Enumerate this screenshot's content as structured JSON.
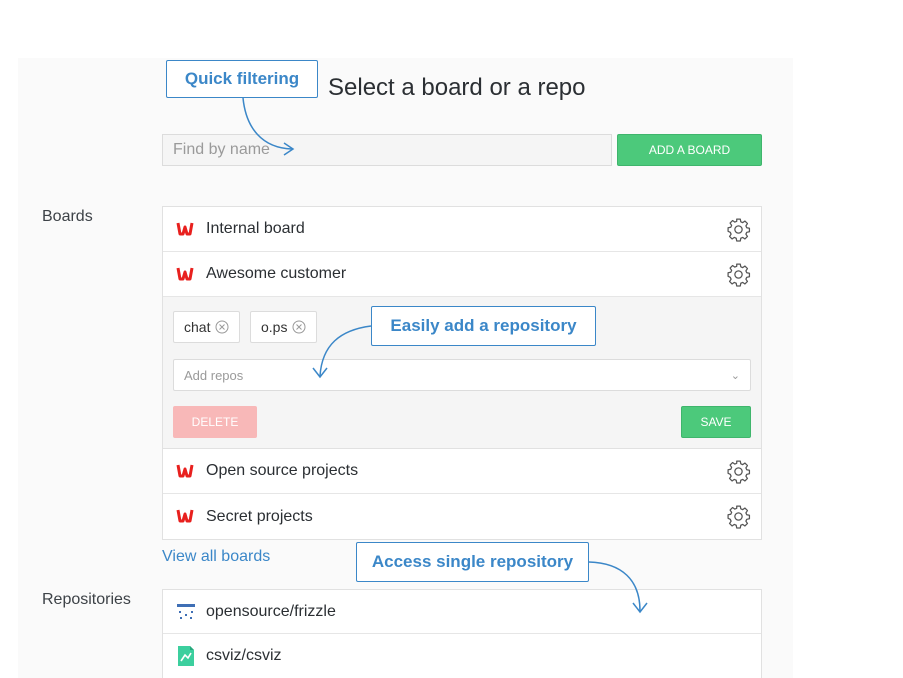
{
  "header": {
    "title": "Select a board or a repo"
  },
  "search": {
    "placeholder": "Find by name"
  },
  "toolbar": {
    "add_board_label": "ADD A BOARD"
  },
  "sections": {
    "boards_label": "Boards",
    "repositories_label": "Repositories"
  },
  "boards": [
    {
      "name": "Internal board"
    },
    {
      "name": "Awesome customer"
    },
    {
      "name": "Open source projects"
    },
    {
      "name": "Secret projects"
    }
  ],
  "editor": {
    "chips": [
      {
        "label": "chat"
      },
      {
        "label": "o.ps"
      }
    ],
    "add_repos_placeholder": "Add repos",
    "delete_label": "DELETE",
    "save_label": "SAVE"
  },
  "view_all_boards": "View all boards",
  "repositories": [
    {
      "name": "opensource/frizzle"
    },
    {
      "name": "csviz/csviz"
    }
  ],
  "callouts": {
    "quick_filtering": "Quick filtering",
    "easily_add": "Easily add a repository",
    "access_single": "Access single repository"
  },
  "colors": {
    "accent_green": "#4cc97b",
    "link_blue": "#3b87c8",
    "delete_pink": "#f8b8b8",
    "brand_red": "#e8201e"
  },
  "icons": {
    "board_logo": "waffle-logo-icon",
    "settings": "gear-icon",
    "remove_chip": "circle-x-icon",
    "dropdown": "chevron-down-icon"
  }
}
